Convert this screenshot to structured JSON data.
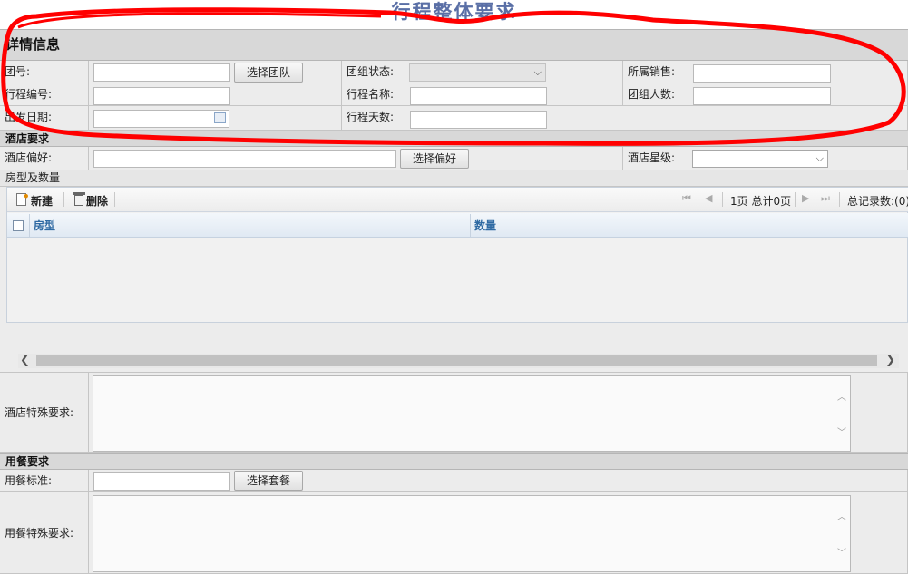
{
  "page_title": "行程整体要求",
  "detail": {
    "heading": "详情信息",
    "group_no_label": "团号:",
    "select_group_btn": "选择团队",
    "group_status_label": "团组状态:",
    "sales_label": "所属销售:",
    "itinerary_no_label": "行程编号:",
    "itinerary_name_label": "行程名称:",
    "group_size_label": "团组人数:",
    "depart_date_label": "出发日期:",
    "itinerary_days_label": "行程天数:"
  },
  "hotel": {
    "heading": "酒店要求",
    "pref_label": "酒店偏好:",
    "select_pref_btn": "选择偏好",
    "star_label": "酒店星级:",
    "rooms_heading": "房型及数量",
    "toolbar": {
      "new_label": "新建",
      "delete_label": "删除",
      "page_info": "1页 总计0页",
      "total_records": "总记录数:(0)"
    },
    "columns": [
      "房型",
      "数量"
    ],
    "special_label": "酒店特殊要求:"
  },
  "meal": {
    "heading": "用餐要求",
    "standard_label": "用餐标准:",
    "select_package_btn": "选择套餐",
    "special_label": "用餐特殊要求:"
  },
  "colors": {
    "annotation_red": "#ff0000",
    "header_blue": "#2f6aa3"
  }
}
